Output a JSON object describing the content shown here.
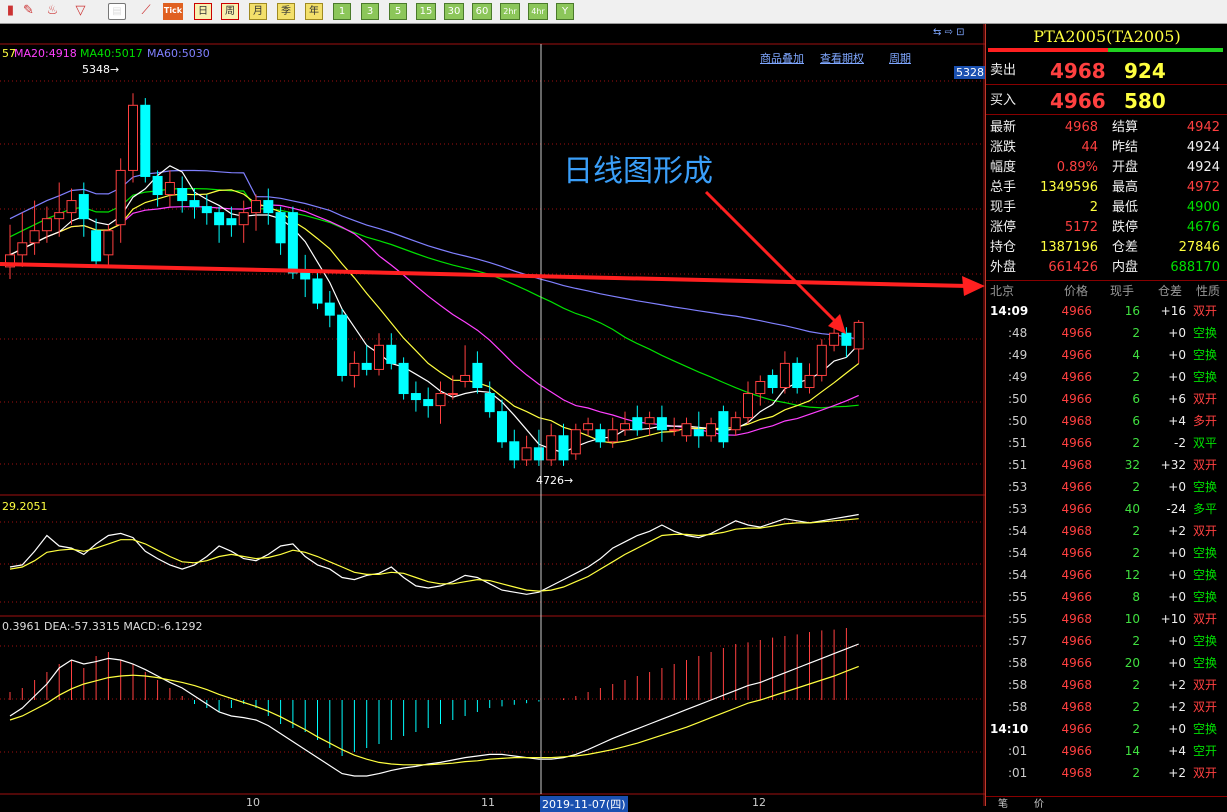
{
  "toolbar": {
    "tick_label": "Tick",
    "periods": [
      "日",
      "周",
      "月",
      "季",
      "年",
      "1",
      "3",
      "5",
      "15",
      "30",
      "60",
      "2hr",
      "4hr",
      "Y"
    ]
  },
  "chart": {
    "links": [
      "商品叠加",
      "查看期权",
      "周期"
    ],
    "ma_values": {
      "ma10_tail": "57",
      "ma20": "MA20:4918",
      "ma40": "MA40:5017",
      "ma60": "MA60:5030"
    },
    "high_marker": "5348→",
    "low_marker": "4726→",
    "axis_price_tag": "5328",
    "annotation": "日线图形成",
    "kdj_label": "29.2051",
    "macd_label": "0.3961  DEA:-57.3315  MACD:-6.1292",
    "date_labels": [
      "10",
      "11",
      "12"
    ],
    "cursor_date": "2019-11-07(四)",
    "colors": {
      "up": "#ff4040",
      "down": "#00ffff",
      "ma5": "#ffffff",
      "ma10": "#ffff40",
      "ma20": "#ff40ff",
      "ma40": "#00e000",
      "ma60": "#8080ff",
      "grid": "#a01010",
      "arrow": "#ff2020"
    }
  },
  "panel": {
    "title": "PTA2005(TA2005)",
    "sell_label": "卖出",
    "sell_price": "4968",
    "sell_vol": "924",
    "buy_label": "买入",
    "buy_price": "4966",
    "buy_vol": "580",
    "stats": [
      {
        "k1": "最新",
        "v1": "4968",
        "c1": "red",
        "k2": "结算",
        "v2": "4942",
        "c2": "red"
      },
      {
        "k1": "涨跌",
        "v1": "44",
        "c1": "red",
        "k2": "昨结",
        "v2": "4924",
        "c2": "white"
      },
      {
        "k1": "幅度",
        "v1": "0.89%",
        "c1": "red",
        "k2": "开盘",
        "v2": "4924",
        "c2": "white"
      },
      {
        "k1": "总手",
        "v1": "1349596",
        "c1": "yellow",
        "k2": "最高",
        "v2": "4972",
        "c2": "red"
      },
      {
        "k1": "现手",
        "v1": "2",
        "c1": "yellow",
        "k2": "最低",
        "v2": "4900",
        "c2": "green"
      },
      {
        "k1": "涨停",
        "v1": "5172",
        "c1": "red",
        "k2": "跌停",
        "v2": "4676",
        "c2": "green"
      },
      {
        "k1": "持仓",
        "v1": "1387196",
        "c1": "yellow",
        "k2": "仓差",
        "v2": "27846",
        "c2": "yellow"
      },
      {
        "k1": "外盘",
        "v1": "661426",
        "c1": "red",
        "k2": "内盘",
        "v2": "688170",
        "c2": "green"
      }
    ],
    "tick_headers": [
      "北京",
      "价格",
      "现手",
      "仓差",
      "性质"
    ],
    "ticks": [
      {
        "t": "14:09",
        "p": "4966",
        "pc": "red",
        "v": "16",
        "d": "+16",
        "n": "双开",
        "nc": "red"
      },
      {
        "t": ":48",
        "p": "4966",
        "pc": "red",
        "v": "2",
        "d": "+0",
        "n": "空换",
        "nc": "green"
      },
      {
        "t": ":49",
        "p": "4966",
        "pc": "red",
        "v": "4",
        "d": "+0",
        "n": "空换",
        "nc": "green"
      },
      {
        "t": ":49",
        "p": "4966",
        "pc": "red",
        "v": "2",
        "d": "+0",
        "n": "空换",
        "nc": "green"
      },
      {
        "t": ":50",
        "p": "4966",
        "pc": "red",
        "v": "6",
        "d": "+6",
        "n": "双开",
        "nc": "red"
      },
      {
        "t": ":50",
        "p": "4968",
        "pc": "red",
        "v": "6",
        "d": "+4",
        "n": "多开",
        "nc": "red"
      },
      {
        "t": ":51",
        "p": "4966",
        "pc": "red",
        "v": "2",
        "d": "-2",
        "n": "双平",
        "nc": "green"
      },
      {
        "t": ":51",
        "p": "4968",
        "pc": "red",
        "v": "32",
        "d": "+32",
        "n": "双开",
        "nc": "red"
      },
      {
        "t": ":53",
        "p": "4966",
        "pc": "red",
        "v": "2",
        "d": "+0",
        "n": "空换",
        "nc": "green"
      },
      {
        "t": ":53",
        "p": "4966",
        "pc": "red",
        "v": "40",
        "d": "-24",
        "n": "多平",
        "nc": "green"
      },
      {
        "t": ":54",
        "p": "4968",
        "pc": "red",
        "v": "2",
        "d": "+2",
        "n": "双开",
        "nc": "red"
      },
      {
        "t": ":54",
        "p": "4966",
        "pc": "red",
        "v": "2",
        "d": "+0",
        "n": "空换",
        "nc": "green"
      },
      {
        "t": ":54",
        "p": "4966",
        "pc": "red",
        "v": "12",
        "d": "+0",
        "n": "空换",
        "nc": "green"
      },
      {
        "t": ":55",
        "p": "4966",
        "pc": "red",
        "v": "8",
        "d": "+0",
        "n": "空换",
        "nc": "green"
      },
      {
        "t": ":55",
        "p": "4968",
        "pc": "red",
        "v": "10",
        "d": "+10",
        "n": "双开",
        "nc": "red"
      },
      {
        "t": ":57",
        "p": "4966",
        "pc": "red",
        "v": "2",
        "d": "+0",
        "n": "空换",
        "nc": "green"
      },
      {
        "t": ":58",
        "p": "4966",
        "pc": "red",
        "v": "20",
        "d": "+0",
        "n": "空换",
        "nc": "green"
      },
      {
        "t": ":58",
        "p": "4968",
        "pc": "red",
        "v": "2",
        "d": "+2",
        "n": "双开",
        "nc": "red"
      },
      {
        "t": ":58",
        "p": "4968",
        "pc": "red",
        "v": "2",
        "d": "+2",
        "n": "双开",
        "nc": "red"
      },
      {
        "t": "14:10",
        "p": "4966",
        "pc": "red",
        "v": "2",
        "d": "+0",
        "n": "空换",
        "nc": "green"
      },
      {
        "t": ":01",
        "p": "4966",
        "pc": "red",
        "v": "14",
        "d": "+4",
        "n": "空开",
        "nc": "green"
      },
      {
        "t": ":01",
        "p": "4968",
        "pc": "red",
        "v": "2",
        "d": "+2",
        "n": "双开",
        "nc": "red"
      }
    ],
    "bottom_tabs": [
      "笔",
      "价"
    ]
  },
  "candles": [
    {
      "o": 5060,
      "c": 5080,
      "h": 5130,
      "l": 5040
    },
    {
      "o": 5080,
      "c": 5100,
      "h": 5150,
      "l": 5060
    },
    {
      "o": 5100,
      "c": 5120,
      "h": 5170,
      "l": 5080
    },
    {
      "o": 5120,
      "c": 5140,
      "h": 5160,
      "l": 5100
    },
    {
      "o": 5140,
      "c": 5150,
      "h": 5200,
      "l": 5110
    },
    {
      "o": 5150,
      "c": 5170,
      "h": 5190,
      "l": 5130
    },
    {
      "o": 5180,
      "c": 5140,
      "h": 5200,
      "l": 5110
    },
    {
      "o": 5120,
      "c": 5070,
      "h": 5140,
      "l": 5060
    },
    {
      "o": 5080,
      "c": 5120,
      "h": 5130,
      "l": 5060
    },
    {
      "o": 5130,
      "c": 5220,
      "h": 5240,
      "l": 5100
    },
    {
      "o": 5220,
      "c": 5328,
      "h": 5348,
      "l": 5200
    },
    {
      "o": 5328,
      "c": 5210,
      "h": 5340,
      "l": 5200
    },
    {
      "o": 5210,
      "c": 5180,
      "h": 5220,
      "l": 5160
    },
    {
      "o": 5180,
      "c": 5200,
      "h": 5220,
      "l": 5160
    },
    {
      "o": 5190,
      "c": 5170,
      "h": 5210,
      "l": 5150
    },
    {
      "o": 5170,
      "c": 5160,
      "h": 5190,
      "l": 5140
    },
    {
      "o": 5160,
      "c": 5150,
      "h": 5180,
      "l": 5130
    },
    {
      "o": 5150,
      "c": 5130,
      "h": 5160,
      "l": 5100
    },
    {
      "o": 5140,
      "c": 5130,
      "h": 5160,
      "l": 5110
    },
    {
      "o": 5130,
      "c": 5150,
      "h": 5170,
      "l": 5100
    },
    {
      "o": 5150,
      "c": 5170,
      "h": 5180,
      "l": 5120
    },
    {
      "o": 5170,
      "c": 5150,
      "h": 5190,
      "l": 5130
    },
    {
      "o": 5150,
      "c": 5100,
      "h": 5160,
      "l": 5080
    },
    {
      "o": 5150,
      "c": 5050,
      "h": 5160,
      "l": 5040
    },
    {
      "o": 5050,
      "c": 5040,
      "h": 5080,
      "l": 5010
    },
    {
      "o": 5040,
      "c": 5000,
      "h": 5050,
      "l": 4990
    },
    {
      "o": 5000,
      "c": 4980,
      "h": 5020,
      "l": 4960
    },
    {
      "o": 4980,
      "c": 4880,
      "h": 4990,
      "l": 4870
    },
    {
      "o": 4880,
      "c": 4900,
      "h": 4920,
      "l": 4860
    },
    {
      "o": 4900,
      "c": 4890,
      "h": 4930,
      "l": 4880
    },
    {
      "o": 4890,
      "c": 4930,
      "h": 4950,
      "l": 4880
    },
    {
      "o": 4930,
      "c": 4900,
      "h": 4950,
      "l": 4890
    },
    {
      "o": 4900,
      "c": 4850,
      "h": 4910,
      "l": 4840
    },
    {
      "o": 4850,
      "c": 4840,
      "h": 4870,
      "l": 4820
    },
    {
      "o": 4840,
      "c": 4830,
      "h": 4860,
      "l": 4810
    },
    {
      "o": 4830,
      "c": 4850,
      "h": 4870,
      "l": 4800
    },
    {
      "o": 4850,
      "c": 4850,
      "h": 4880,
      "l": 4840
    },
    {
      "o": 4870,
      "c": 4880,
      "h": 4930,
      "l": 4860
    },
    {
      "o": 4900,
      "c": 4860,
      "h": 4920,
      "l": 4850
    },
    {
      "o": 4850,
      "c": 4820,
      "h": 4870,
      "l": 4810
    },
    {
      "o": 4820,
      "c": 4770,
      "h": 4840,
      "l": 4760
    },
    {
      "o": 4770,
      "c": 4740,
      "h": 4790,
      "l": 4726
    },
    {
      "o": 4740,
      "c": 4760,
      "h": 4780,
      "l": 4730
    },
    {
      "o": 4760,
      "c": 4740,
      "h": 4790,
      "l": 4730
    },
    {
      "o": 4740,
      "c": 4780,
      "h": 4800,
      "l": 4730
    },
    {
      "o": 4780,
      "c": 4740,
      "h": 4800,
      "l": 4730
    },
    {
      "o": 4750,
      "c": 4790,
      "h": 4800,
      "l": 4740
    },
    {
      "o": 4790,
      "c": 4800,
      "h": 4810,
      "l": 4780
    },
    {
      "o": 4790,
      "c": 4770,
      "h": 4800,
      "l": 4760
    },
    {
      "o": 4770,
      "c": 4790,
      "h": 4810,
      "l": 4760
    },
    {
      "o": 4790,
      "c": 4800,
      "h": 4820,
      "l": 4780
    },
    {
      "o": 4810,
      "c": 4790,
      "h": 4830,
      "l": 4780
    },
    {
      "o": 4800,
      "c": 4810,
      "h": 4820,
      "l": 4780
    },
    {
      "o": 4810,
      "c": 4790,
      "h": 4830,
      "l": 4770
    },
    {
      "o": 4790,
      "c": 4790,
      "h": 4810,
      "l": 4780
    },
    {
      "o": 4780,
      "c": 4800,
      "h": 4810,
      "l": 4770
    },
    {
      "o": 4790,
      "c": 4780,
      "h": 4820,
      "l": 4760
    },
    {
      "o": 4780,
      "c": 4800,
      "h": 4810,
      "l": 4770
    },
    {
      "o": 4820,
      "c": 4770,
      "h": 4830,
      "l": 4760
    },
    {
      "o": 4790,
      "c": 4810,
      "h": 4820,
      "l": 4780
    },
    {
      "o": 4810,
      "c": 4850,
      "h": 4870,
      "l": 4800
    },
    {
      "o": 4850,
      "c": 4870,
      "h": 4880,
      "l": 4830
    },
    {
      "o": 4880,
      "c": 4860,
      "h": 4890,
      "l": 4850
    },
    {
      "o": 4860,
      "c": 4900,
      "h": 4920,
      "l": 4850
    },
    {
      "o": 4900,
      "c": 4860,
      "h": 4910,
      "l": 4850
    },
    {
      "o": 4860,
      "c": 4880,
      "h": 4900,
      "l": 4850
    },
    {
      "o": 4880,
      "c": 4930,
      "h": 4940,
      "l": 4870
    },
    {
      "o": 4930,
      "c": 4950,
      "h": 4960,
      "l": 4920
    },
    {
      "o": 4950,
      "c": 4930,
      "h": 4960,
      "l": 4910
    },
    {
      "o": 4924,
      "c": 4968,
      "h": 4972,
      "l": 4900
    }
  ],
  "ind": {
    "kdj_fast": [
      40,
      42,
      55,
      70,
      60,
      58,
      52,
      62,
      70,
      72,
      68,
      55,
      48,
      42,
      38,
      42,
      50,
      60,
      55,
      48,
      46,
      52,
      60,
      62,
      50,
      42,
      38,
      30,
      28,
      32,
      34,
      40,
      30,
      22,
      20,
      22,
      26,
      32,
      30,
      24,
      18,
      16,
      14,
      16,
      22,
      28,
      34,
      40,
      48,
      58,
      64,
      70,
      74,
      80,
      74,
      70,
      68,
      72,
      78,
      84,
      80,
      78,
      82,
      86,
      84,
      82,
      84,
      86,
      88,
      90
    ],
    "kdj_slow": [
      38,
      40,
      46,
      54,
      56,
      57,
      55,
      58,
      62,
      66,
      66,
      62,
      56,
      50,
      45,
      44,
      46,
      50,
      52,
      50,
      48,
      49,
      52,
      56,
      54,
      50,
      45,
      40,
      35,
      33,
      33,
      35,
      34,
      30,
      26,
      24,
      24,
      26,
      28,
      27,
      24,
      21,
      18,
      17,
      18,
      21,
      26,
      31,
      38,
      45,
      52,
      58,
      64,
      70,
      71,
      71,
      70,
      71,
      73,
      76,
      77,
      77,
      79,
      81,
      82,
      82,
      83,
      84,
      85,
      86
    ],
    "macd_hist": [
      10,
      15,
      25,
      35,
      45,
      50,
      40,
      55,
      60,
      50,
      45,
      35,
      25,
      15,
      5,
      -5,
      -10,
      -15,
      -10,
      -5,
      -10,
      -20,
      -30,
      -35,
      -40,
      -50,
      -60,
      -70,
      -65,
      -60,
      -55,
      -50,
      -45,
      -40,
      -35,
      -30,
      -25,
      -20,
      -15,
      -10,
      -8,
      -6,
      -4,
      -2,
      0,
      2,
      5,
      10,
      15,
      20,
      25,
      30,
      35,
      40,
      45,
      50,
      55,
      60,
      65,
      70,
      72,
      75,
      78,
      80,
      82,
      85,
      87,
      88,
      90
    ],
    "dif": [
      -20,
      -10,
      5,
      20,
      40,
      50,
      45,
      48,
      52,
      50,
      45,
      38,
      30,
      22,
      15,
      5,
      -5,
      -15,
      -20,
      -22,
      -25,
      -32,
      -42,
      -52,
      -62,
      -72,
      -82,
      -92,
      -95,
      -95,
      -92,
      -88,
      -85,
      -83,
      -80,
      -78,
      -75,
      -72,
      -70,
      -68,
      -68,
      -70,
      -72,
      -74,
      -74,
      -72,
      -68,
      -62,
      -55,
      -48,
      -42,
      -36,
      -30,
      -24,
      -18,
      -12,
      -6,
      0,
      6,
      12,
      18,
      22,
      28,
      34,
      40,
      46,
      52,
      58,
      64,
      70
    ],
    "dea": [
      -25,
      -20,
      -12,
      -4,
      6,
      14,
      20,
      24,
      28,
      30,
      31,
      30,
      28,
      25,
      22,
      18,
      13,
      7,
      2,
      -3,
      -8,
      -14,
      -21,
      -29,
      -37,
      -46,
      -54,
      -62,
      -69,
      -74,
      -78,
      -80,
      -81,
      -81,
      -81,
      -80,
      -79,
      -77,
      -76,
      -74,
      -73,
      -72,
      -72,
      -72,
      -72,
      -71,
      -70,
      -68,
      -65,
      -62,
      -58,
      -54,
      -49,
      -44,
      -39,
      -34,
      -28,
      -22,
      -16,
      -10,
      -4,
      0,
      5,
      10,
      15,
      20,
      25,
      30,
      36,
      42
    ]
  }
}
